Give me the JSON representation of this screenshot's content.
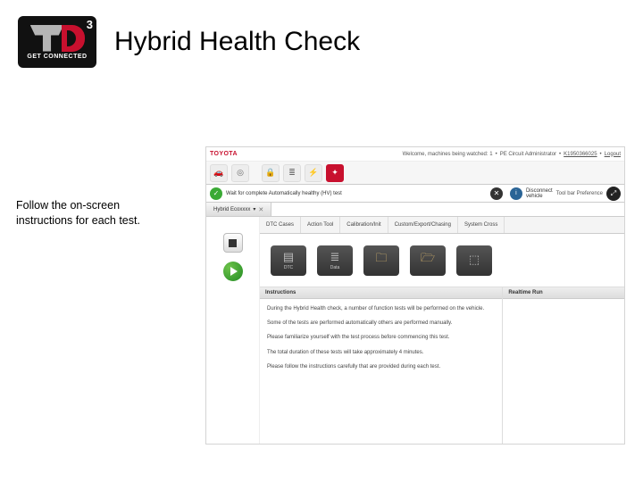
{
  "logo": {
    "main": "TD",
    "sup": "3",
    "sub": "GET CONNECTED"
  },
  "page_title": "Hybrid Health Check",
  "instruction": "Follow the on-screen instructions for each test.",
  "app": {
    "brand": "TOYOTA",
    "top_right": {
      "vehicles": "Welcome, machines being watched: 1",
      "role": "PE Circuit Administrator",
      "user": "K1950366025",
      "logout": "Logout"
    },
    "notice": {
      "text": "Wait for complete Automatically healthy (HV) test",
      "alt": "Disconnect vehicle",
      "tool": "Tool bar Preference"
    },
    "tab": {
      "label": "Hybrid Ecoxxxx"
    },
    "categories": [
      "DTC Cases",
      "Action Tool",
      "Calibration/Init",
      "Custom/Export/Chasing",
      "System Cross"
    ],
    "icons": [
      {
        "name": "dtc",
        "label": "DTC"
      },
      {
        "name": "data",
        "label": "Data"
      },
      {
        "name": "folder",
        "label": ""
      },
      {
        "name": "utility",
        "label": ""
      },
      {
        "name": "other",
        "label": ""
      }
    ],
    "panels": {
      "instructions": {
        "title": "Instructions",
        "lines": [
          "During the Hybrid Health check, a number of function tests will be performed on the vehicle.",
          "Some of the tests are performed automatically others are performed manually.",
          "Please familiarize yourself with the test process before commencing this test.",
          "The total duration of these tests will take approximately 4 minutes.",
          "Please follow the instructions carefully that are provided during each test."
        ]
      },
      "realtime": {
        "title": "Realtime Run"
      }
    }
  }
}
